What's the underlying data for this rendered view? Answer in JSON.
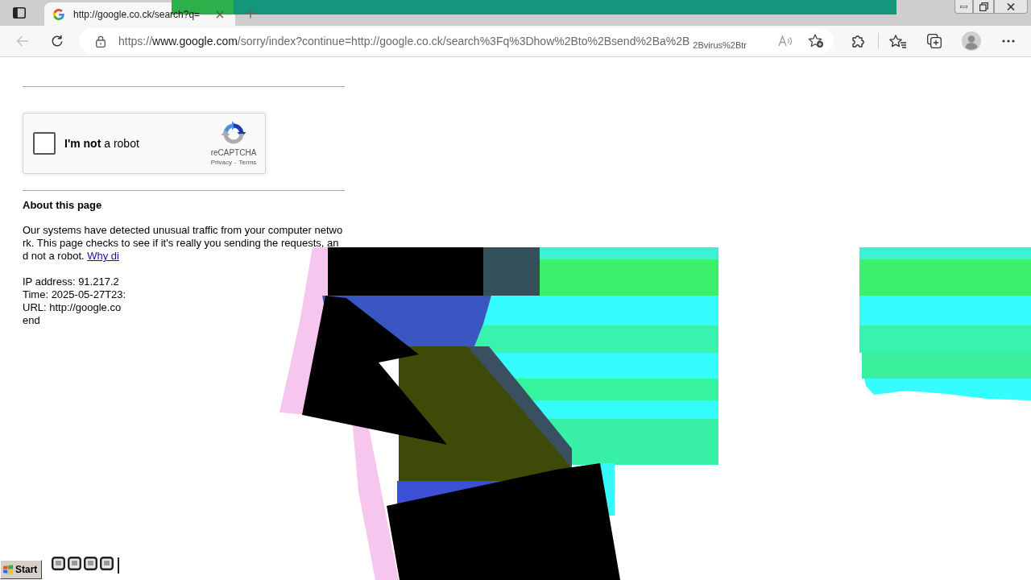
{
  "tab": {
    "title": "http://google.co.ck/search?q="
  },
  "toolbar": {
    "back_disabled": true,
    "address": {
      "scheme": "https://",
      "host": "www.google.com",
      "rest": "/sorry/index?continue=http://google.co.ck/search%3Fq%3Dhow%2Bto%2Bsend%2Ba%2B"
    },
    "ghost_text": "2Bvirus%2Btr"
  },
  "captcha": {
    "checked": false,
    "label": "**I'm not** a robot",
    "brand": "reCAPTCHA",
    "links": [
      "Privacy",
      "Terms"
    ],
    "separator": "-"
  },
  "about": {
    "heading": "About this page",
    "text": "Our systems have detected unusual traffic from your computer network. This page checks to see if it's really you sending the requests, and not a robot.",
    "link": "Why di",
    "details": [
      "IP address: 91.217.2",
      "Time: 2025-05-27T23:",
      "URL: http://google.co",
      "end"
    ]
  },
  "taskbar": {
    "start": "Start"
  }
}
